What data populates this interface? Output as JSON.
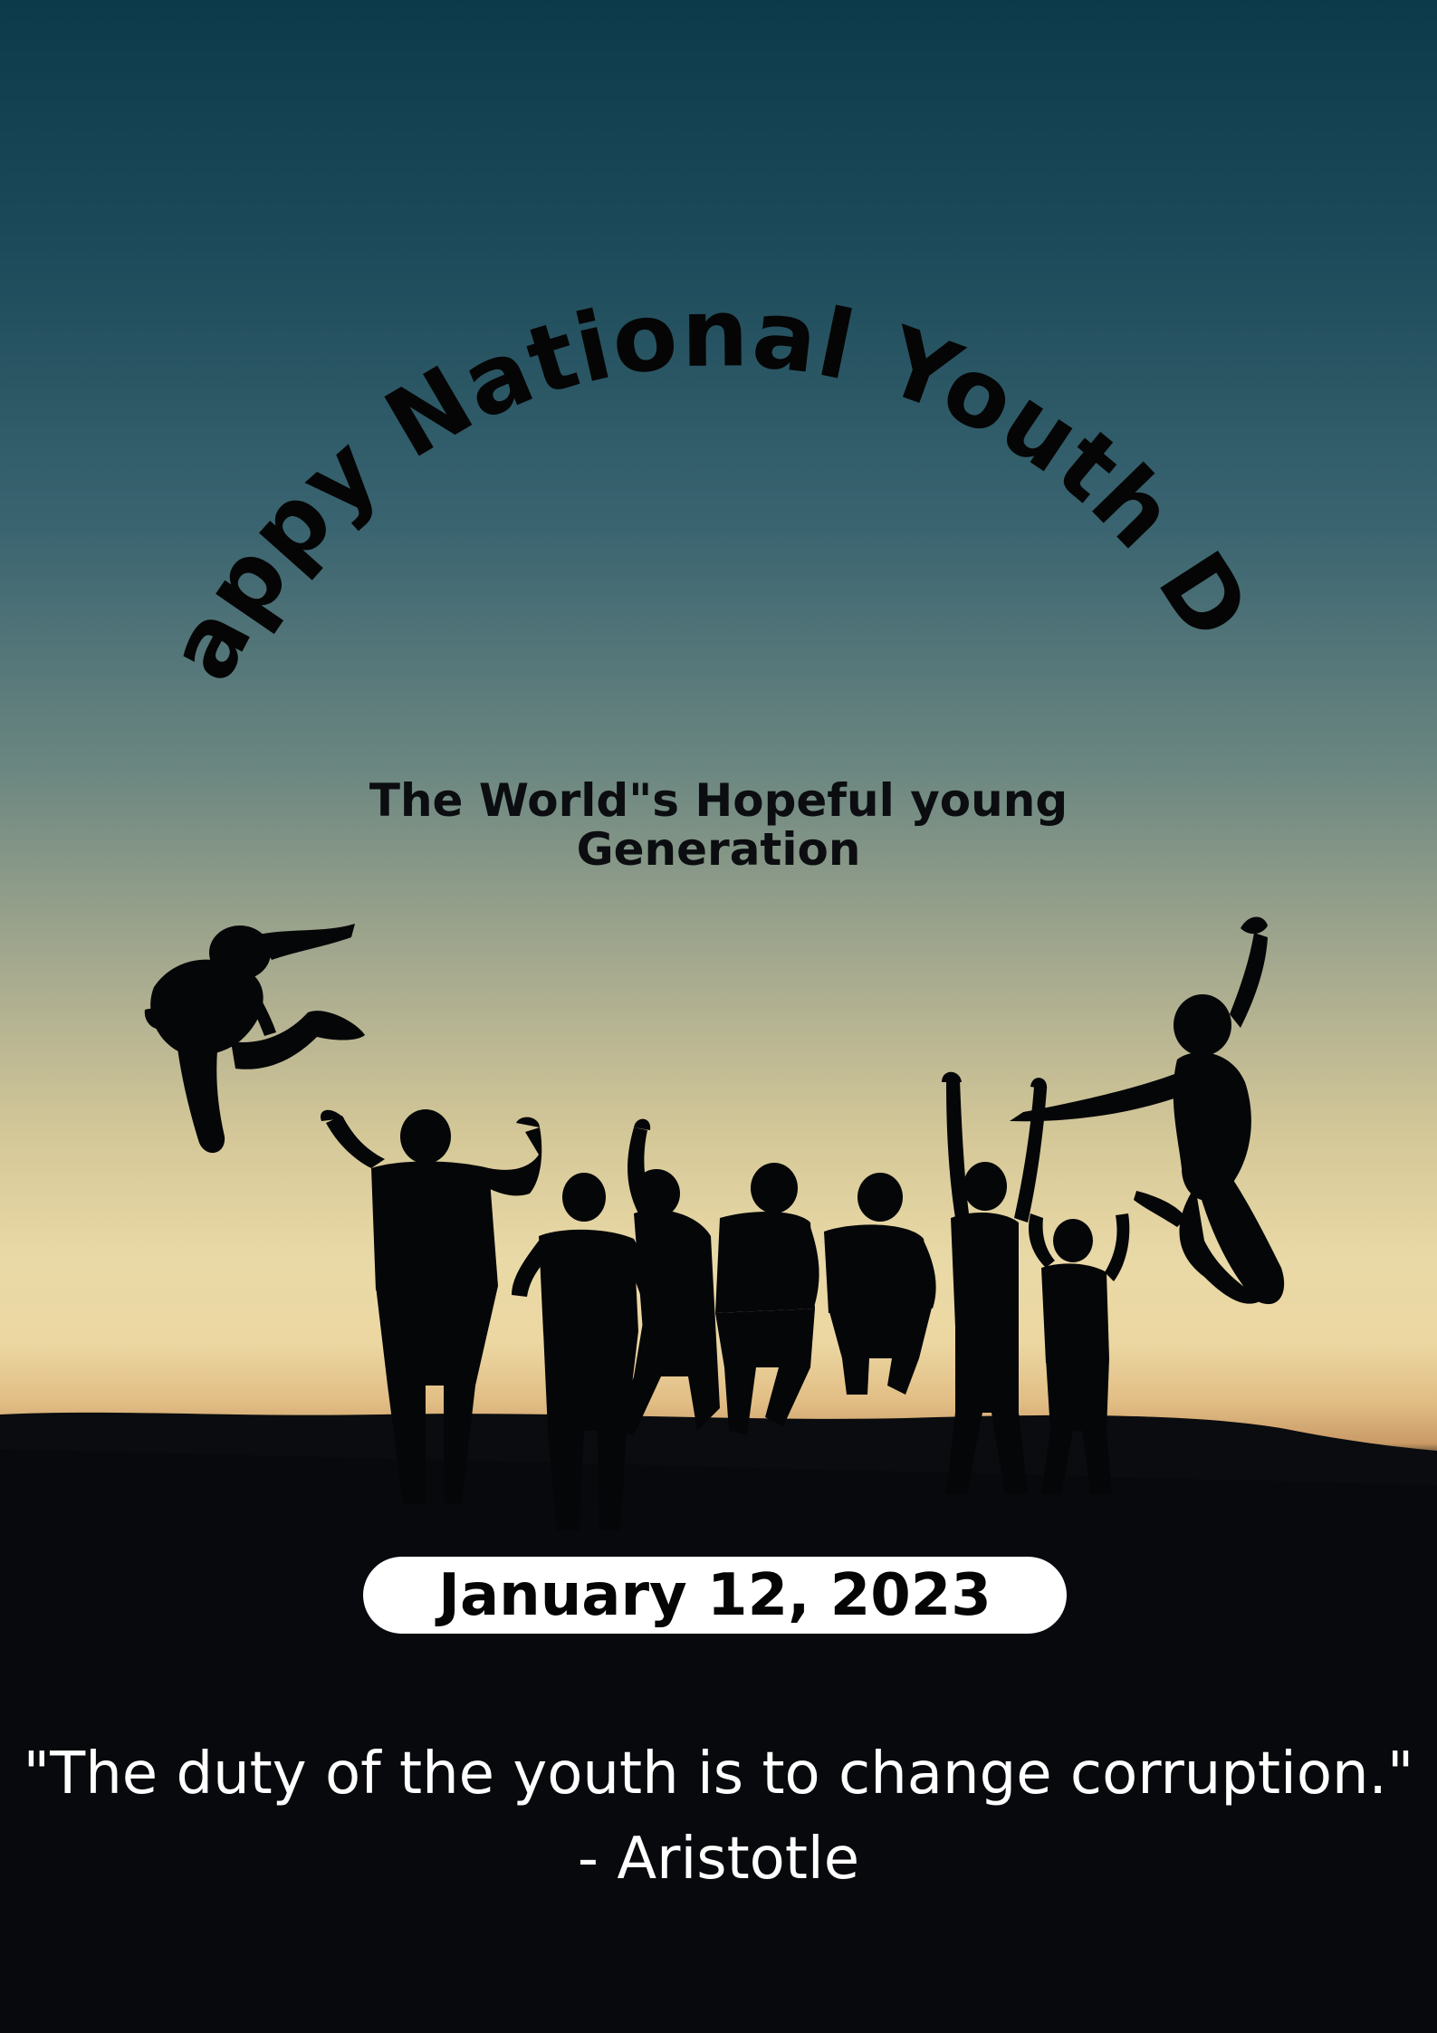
{
  "poster": {
    "title": "Happy National Youth Day",
    "subtitle_line1": "The World\"s Hopeful young",
    "subtitle_line2": "Generation",
    "date": "January 12, 2023",
    "quote_line1": "\"The duty of the youth is to change corruption.\"",
    "quote_line2": "- Aristotle"
  },
  "colors": {
    "sky_top": "#0d3a4b",
    "sky_horizon": "#ecd7a2",
    "ground": "#07090c",
    "title_text": "#050505",
    "quote_text": "#ffffff",
    "date_pill": "#ffffff"
  }
}
